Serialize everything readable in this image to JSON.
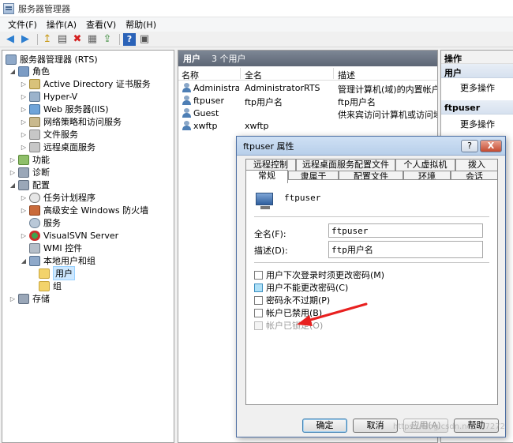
{
  "window": {
    "title": "服务器管理器"
  },
  "menu": [
    "文件(F)",
    "操作(A)",
    "查看(V)",
    "帮助(H)"
  ],
  "toolbar": {
    "icons": [
      "back-icon",
      "forward-icon",
      "up-folder-icon",
      "show-hide-tree-icon",
      "delete-icon",
      "properties-icon",
      "export-icon",
      "help-icon",
      "view-icon"
    ],
    "glyphs": [
      "◀",
      "▶",
      "↥",
      "▤",
      "✖",
      "▦",
      "⇪",
      "?",
      "▣"
    ]
  },
  "tree": {
    "root": "服务器管理器 (RTS)",
    "roles": "角色",
    "ad_cert": "Active Directory 证书服务",
    "hyperv": "Hyper-V",
    "iis": "Web 服务器(IIS)",
    "npas": "网络策略和访问服务",
    "file_services": "文件服务",
    "remote_desktop": "远程桌面服务",
    "features": "功能",
    "diagnostics": "诊断",
    "config": "配置",
    "task_scheduler": "任务计划程序",
    "firewall": "高级安全 Windows 防火墙",
    "services": "服务",
    "visualsvn": "VisualSVN Server",
    "wmi": "WMI 控件",
    "local_users": "本地用户和组",
    "users": "用户",
    "groups": "组",
    "storage": "存储"
  },
  "center": {
    "header": "用户",
    "count": "3 个用户",
    "columns": {
      "name": "名称",
      "fullname": "全名",
      "desc": "描述"
    },
    "rows": [
      {
        "name": "Administrat...",
        "fullname": "AdministratorRTS",
        "desc": "管理计算机(域)的内置帐户"
      },
      {
        "name": "ftpuser",
        "fullname": "ftp用户名",
        "desc": "ftp用户名"
      },
      {
        "name": "Guest",
        "fullname": "",
        "desc": "供来宾访问计算机或访问域的内"
      },
      {
        "name": "xwftp",
        "fullname": "xwftp",
        "desc": ""
      }
    ]
  },
  "actions": {
    "title": "操作",
    "section1": "用户",
    "more1": "更多操作",
    "section2": "ftpuser",
    "more2": "更多操作"
  },
  "dialog": {
    "title": "ftpuser 属性",
    "help_btn": "?",
    "close_btn": "X",
    "tabs_row1": [
      "远程控制",
      "远程桌面服务配置文件",
      "个人虚拟机",
      "拨入"
    ],
    "tabs_row2": [
      "常规",
      "隶属于",
      "配置文件",
      "环境",
      "会话"
    ],
    "username": "ftpuser",
    "fullname_label": "全名(F):",
    "fullname_value": "ftpuser",
    "desc_label": "描述(D):",
    "desc_value": "ftp用户名",
    "cb1": "用户下次登录时须更改密码(M)",
    "cb2": "用户不能更改密码(C)",
    "cb3": "密码永不过期(P)",
    "cb4": "帐户已禁用(B)",
    "cb5": "帐户已锁定(O)",
    "ok": "确定",
    "cancel": "取消",
    "apply": "应用(A)",
    "help": "帮助"
  },
  "watermark": "https://blog.csdn.net/...7272",
  "colors": {
    "accent": "#4d6fa3",
    "header": "#5d6675",
    "arrow": "#e8201f"
  }
}
